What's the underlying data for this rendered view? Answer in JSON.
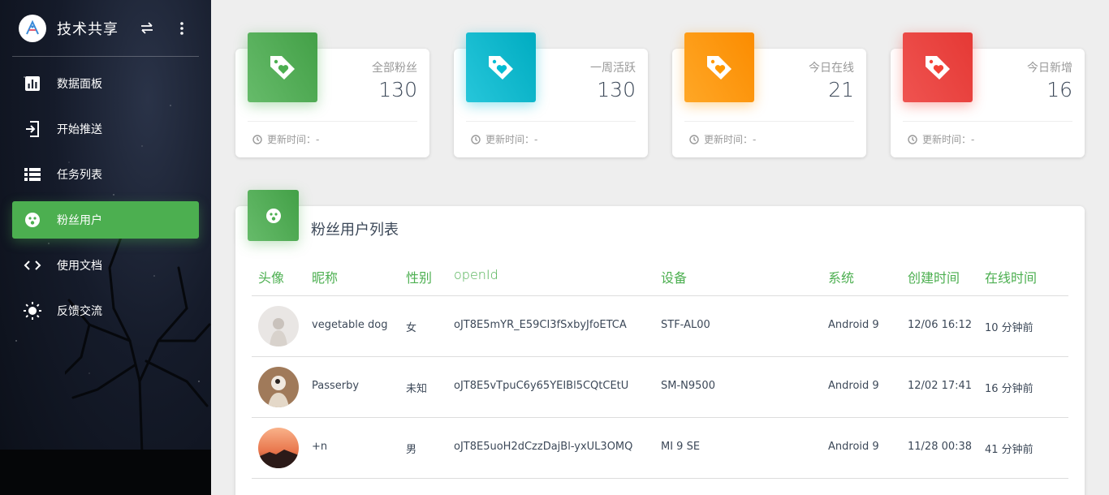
{
  "brand": {
    "title": "技术共享",
    "swap_icon": "swap-arrows-icon",
    "more_icon": "more-vertical-icon"
  },
  "nav": [
    {
      "label": "数据面板",
      "icon": "bar-chart-icon"
    },
    {
      "label": "开始推送",
      "icon": "send-icon"
    },
    {
      "label": "任务列表",
      "icon": "list-icon"
    },
    {
      "label": "粉丝用户",
      "icon": "face-icon",
      "active": true
    },
    {
      "label": "使用文档",
      "icon": "code-icon"
    },
    {
      "label": "反馈交流",
      "icon": "sun-icon"
    }
  ],
  "stats": [
    {
      "label": "全部粉丝",
      "value": "130",
      "foot": "更新时间：-",
      "color": "#4caf50"
    },
    {
      "label": "一周活跃",
      "value": "130",
      "foot": "更新时间：-",
      "color": "#00bcd4"
    },
    {
      "label": "今日在线",
      "value": "21",
      "foot": "更新时间：-",
      "color": "#ff9800"
    },
    {
      "label": "今日新增",
      "value": "16",
      "foot": "更新时间：-",
      "color": "#f44336"
    }
  ],
  "table": {
    "title": "粉丝用户列表",
    "headers": [
      "头像",
      "昵称",
      "性别",
      "openId",
      "设备",
      "系统",
      "创建时间",
      "在线时间"
    ],
    "rows": [
      {
        "nickname": "vegetable dog",
        "gender": "女",
        "openid": "oJT8E5mYR_E59CI3fSxbyJfoETCA",
        "device": "STF-AL00",
        "os": "Android 9",
        "created": "12/06 16:12",
        "online": "10 分钟前"
      },
      {
        "nickname": "Passerby",
        "gender": "未知",
        "openid": "oJT8E5vTpuC6y65YEIBl5CQtCEtU",
        "device": "SM-N9500",
        "os": "Android 9",
        "created": "12/02 17:41",
        "online": "16 分钟前"
      },
      {
        "nickname": "+n",
        "gender": "男",
        "openid": "oJT8E5uoH2dCzzDajBl-yxUL3OMQ",
        "device": "MI 9 SE",
        "os": "Android 9",
        "created": "11/28 00:38",
        "online": "41 分钟前"
      }
    ]
  }
}
